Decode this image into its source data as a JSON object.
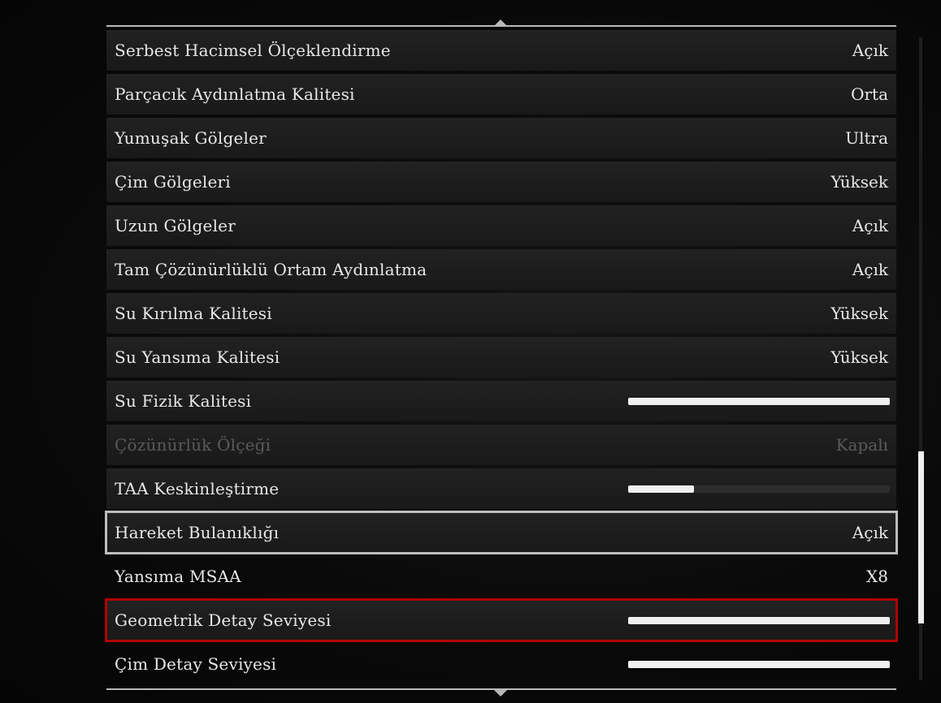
{
  "settings": {
    "rows": [
      {
        "label": "Serbest Hacimsel Ölçeklendirme",
        "value": "Açık",
        "type": "value",
        "state": "normal"
      },
      {
        "label": "Parçacık Aydınlatma Kalitesi",
        "value": "Orta",
        "type": "value",
        "state": "normal"
      },
      {
        "label": "Yumuşak Gölgeler",
        "value": "Ultra",
        "type": "value",
        "state": "normal"
      },
      {
        "label": "Çim Gölgeleri",
        "value": "Yüksek",
        "type": "value",
        "state": "normal"
      },
      {
        "label": "Uzun Gölgeler",
        "value": "Açık",
        "type": "value",
        "state": "normal"
      },
      {
        "label": "Tam Çözünürlüklü Ortam Aydınlatma",
        "value": "Açık",
        "type": "value",
        "state": "normal"
      },
      {
        "label": "Su Kırılma Kalitesi",
        "value": "Yüksek",
        "type": "value",
        "state": "normal"
      },
      {
        "label": "Su Yansıma Kalitesi",
        "value": "Yüksek",
        "type": "value",
        "state": "normal"
      },
      {
        "label": "Su Fizik Kalitesi",
        "type": "slider",
        "level": 1.0,
        "state": "normal"
      },
      {
        "label": "Çözünürlük Ölçeği",
        "value": "Kapalı",
        "type": "value",
        "state": "disabled"
      },
      {
        "label": "TAA Keskinleştirme",
        "type": "slider",
        "level": 0.25,
        "state": "normal"
      },
      {
        "label": "Hareket Bulanıklığı",
        "value": "Açık",
        "type": "value",
        "state": "focus"
      },
      {
        "label": "Yansıma MSAA",
        "value": "X8",
        "type": "value",
        "state": "plain"
      },
      {
        "label": "Geometrik Detay Seviyesi",
        "type": "slider",
        "level": 1.0,
        "state": "selected"
      },
      {
        "label": "Çim Detay Seviyesi",
        "type": "slider",
        "level": 1.0,
        "state": "plain"
      }
    ]
  },
  "colors": {
    "focus_border": "#bdbdbd",
    "selected_border": "#b00000",
    "slider_fill": "#f0f0f0",
    "text": "#e8e8e8",
    "disabled_text": "#5a5a5a"
  },
  "scrollbar": {
    "position_fraction": 0.62,
    "visible_fraction": 0.27
  }
}
